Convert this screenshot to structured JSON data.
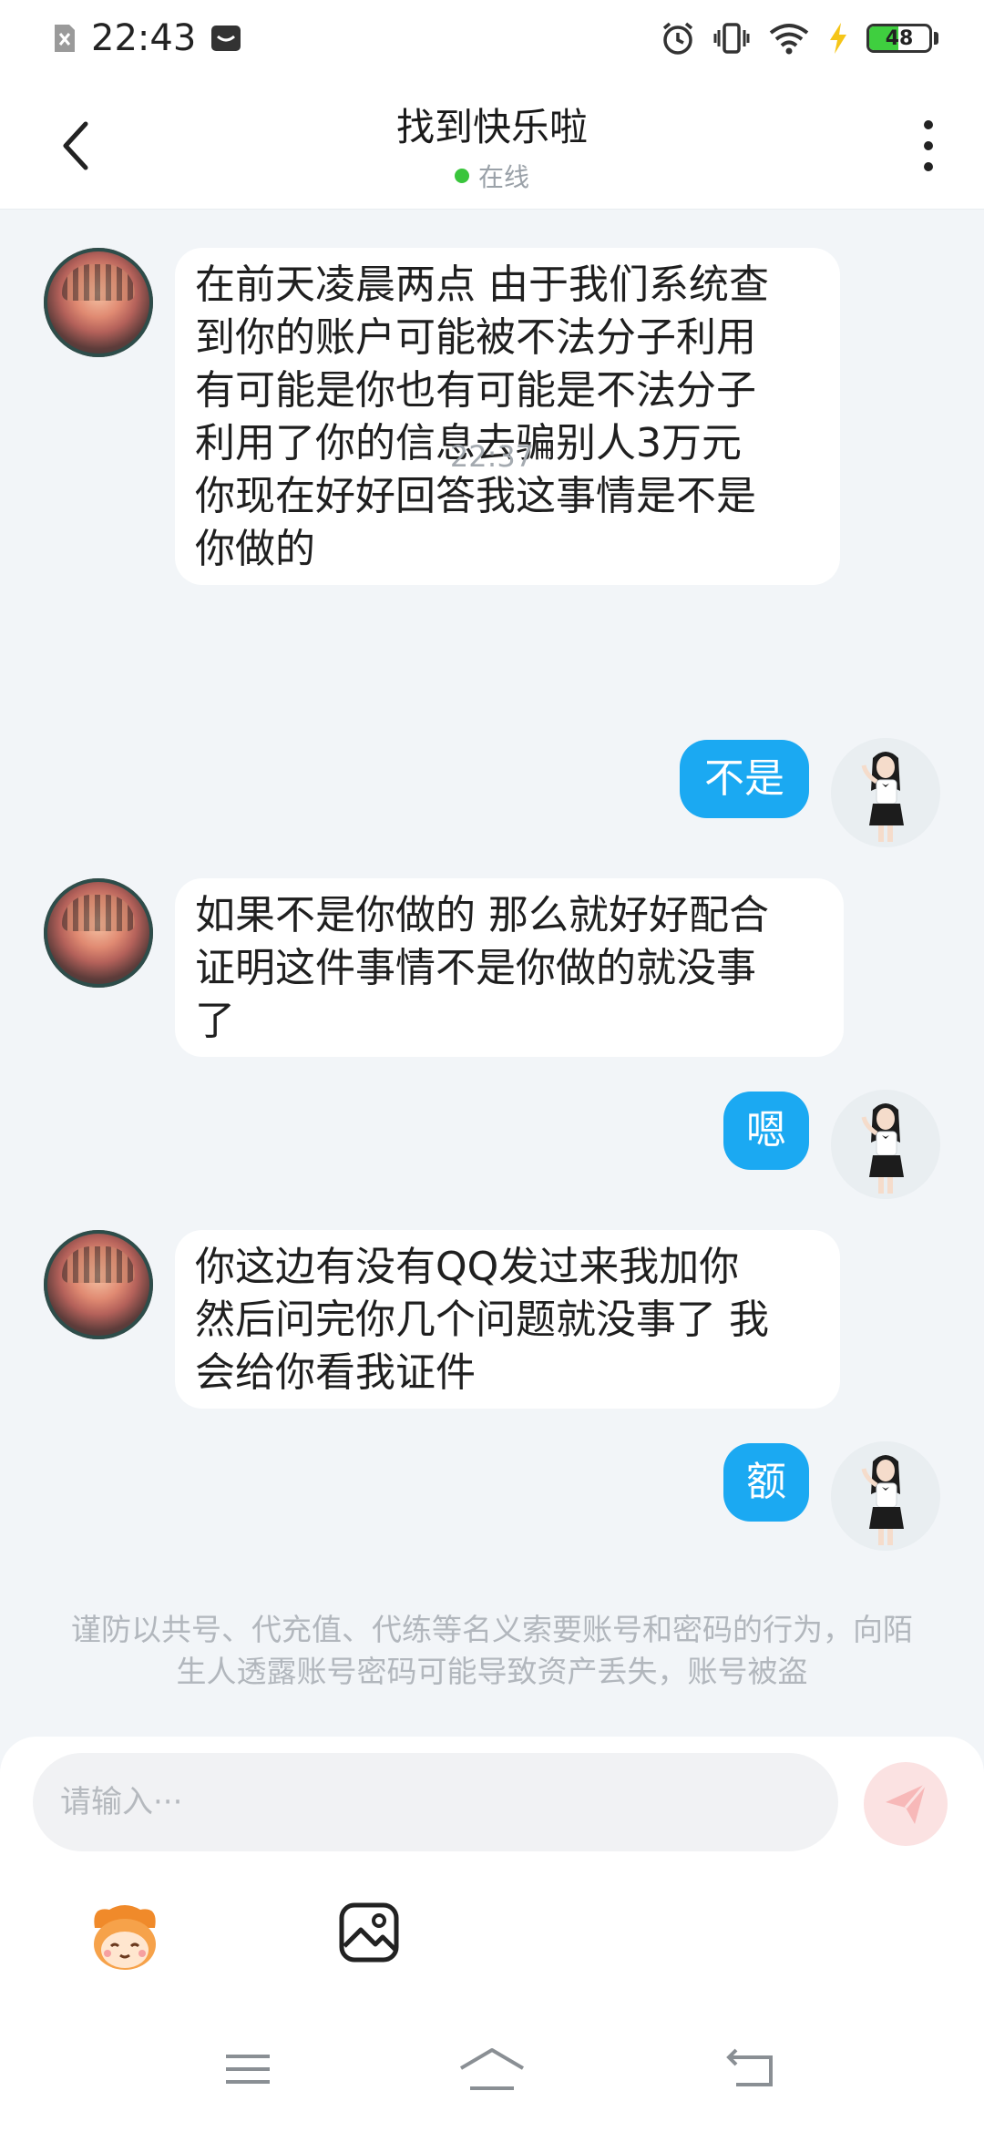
{
  "status_bar": {
    "time": "22:43",
    "battery": "48",
    "battery_level": 0.48
  },
  "header": {
    "title": "找到快乐啦",
    "online_status": "在线"
  },
  "messages": [
    {
      "side": "left",
      "text": "在前天凌晨两点 由于我们系统查\n到你的账户可能被不法分子利用\n有可能是你也有可能是不法分子\n利用了你的信息去骗别人3万元\n你现在好好回答我这事情是不是\n你做的"
    },
    {
      "side": "time",
      "text": "22:37"
    },
    {
      "side": "right",
      "text": "不是"
    },
    {
      "side": "left",
      "text": "如果不是你做的 那么就好好配合\n证明这件事情不是你做的就没事\n了"
    },
    {
      "side": "right",
      "text": "嗯"
    },
    {
      "side": "left",
      "text": "你这边有没有QQ发过来我加你\n然后问完你几个问题就没事了 我\n会给你看我证件"
    },
    {
      "side": "right",
      "text": "额"
    }
  ],
  "warning": "谨防以共号、代充值、代练等名义索要账号和密码的行为，向陌生人透露账号密码可能导致资产丢失，账号被盗",
  "input": {
    "placeholder": "请输入···"
  },
  "icons": {
    "status_left": [
      "no-sim-icon",
      "message-icon"
    ],
    "status_right": [
      "alarm-icon",
      "vibrate-icon",
      "wifi-icon",
      "charging-icon",
      "battery-icon"
    ],
    "header": [
      "back-arrow-icon",
      "more-vertical-icon"
    ],
    "toolbar": [
      "emoji-sticker-icon",
      "image-icon",
      "send-icon"
    ],
    "nav": [
      "menu-icon",
      "home-icon",
      "back-icon"
    ]
  },
  "colors": {
    "sent_bubble": "#1ba9f2",
    "online_dot": "#39c53c",
    "send_button": "#fbe2e2",
    "background": "#f2f5f8"
  }
}
